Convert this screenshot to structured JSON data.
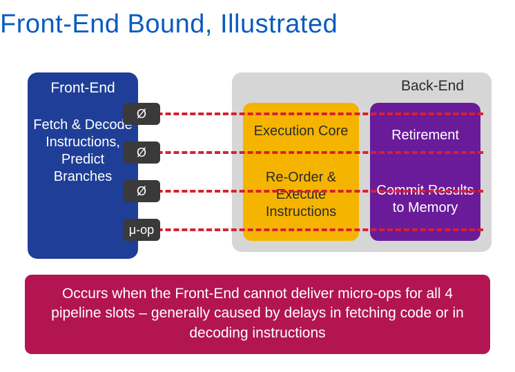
{
  "title": "Front-End Bound, Illustrated",
  "frontend": {
    "label": "Front-End",
    "description": "Fetch & Decode Instructions, Predict Branches"
  },
  "backend": {
    "label": "Back-End",
    "execution": {
      "title": "Execution Core",
      "description": "Re-Order & Execute Instructions"
    },
    "retirement": {
      "title": "Retirement",
      "description": "Commit Results to Memory"
    }
  },
  "slots": [
    "Ø",
    "Ø",
    "Ø",
    "μ-op"
  ],
  "caption": "Occurs when the Front-End cannot deliver micro-ops for all 4 pipeline slots – generally caused by delays in fetching code or in decoding instructions",
  "colors": {
    "title": "#0a5bbf",
    "frontend": "#1f3e97",
    "backend_bg": "#d6d6d6",
    "execution": "#f5b400",
    "retirement": "#6a1b9a",
    "slot": "#3a3a3a",
    "pipe": "#d9202e",
    "caption": "#b21552"
  }
}
